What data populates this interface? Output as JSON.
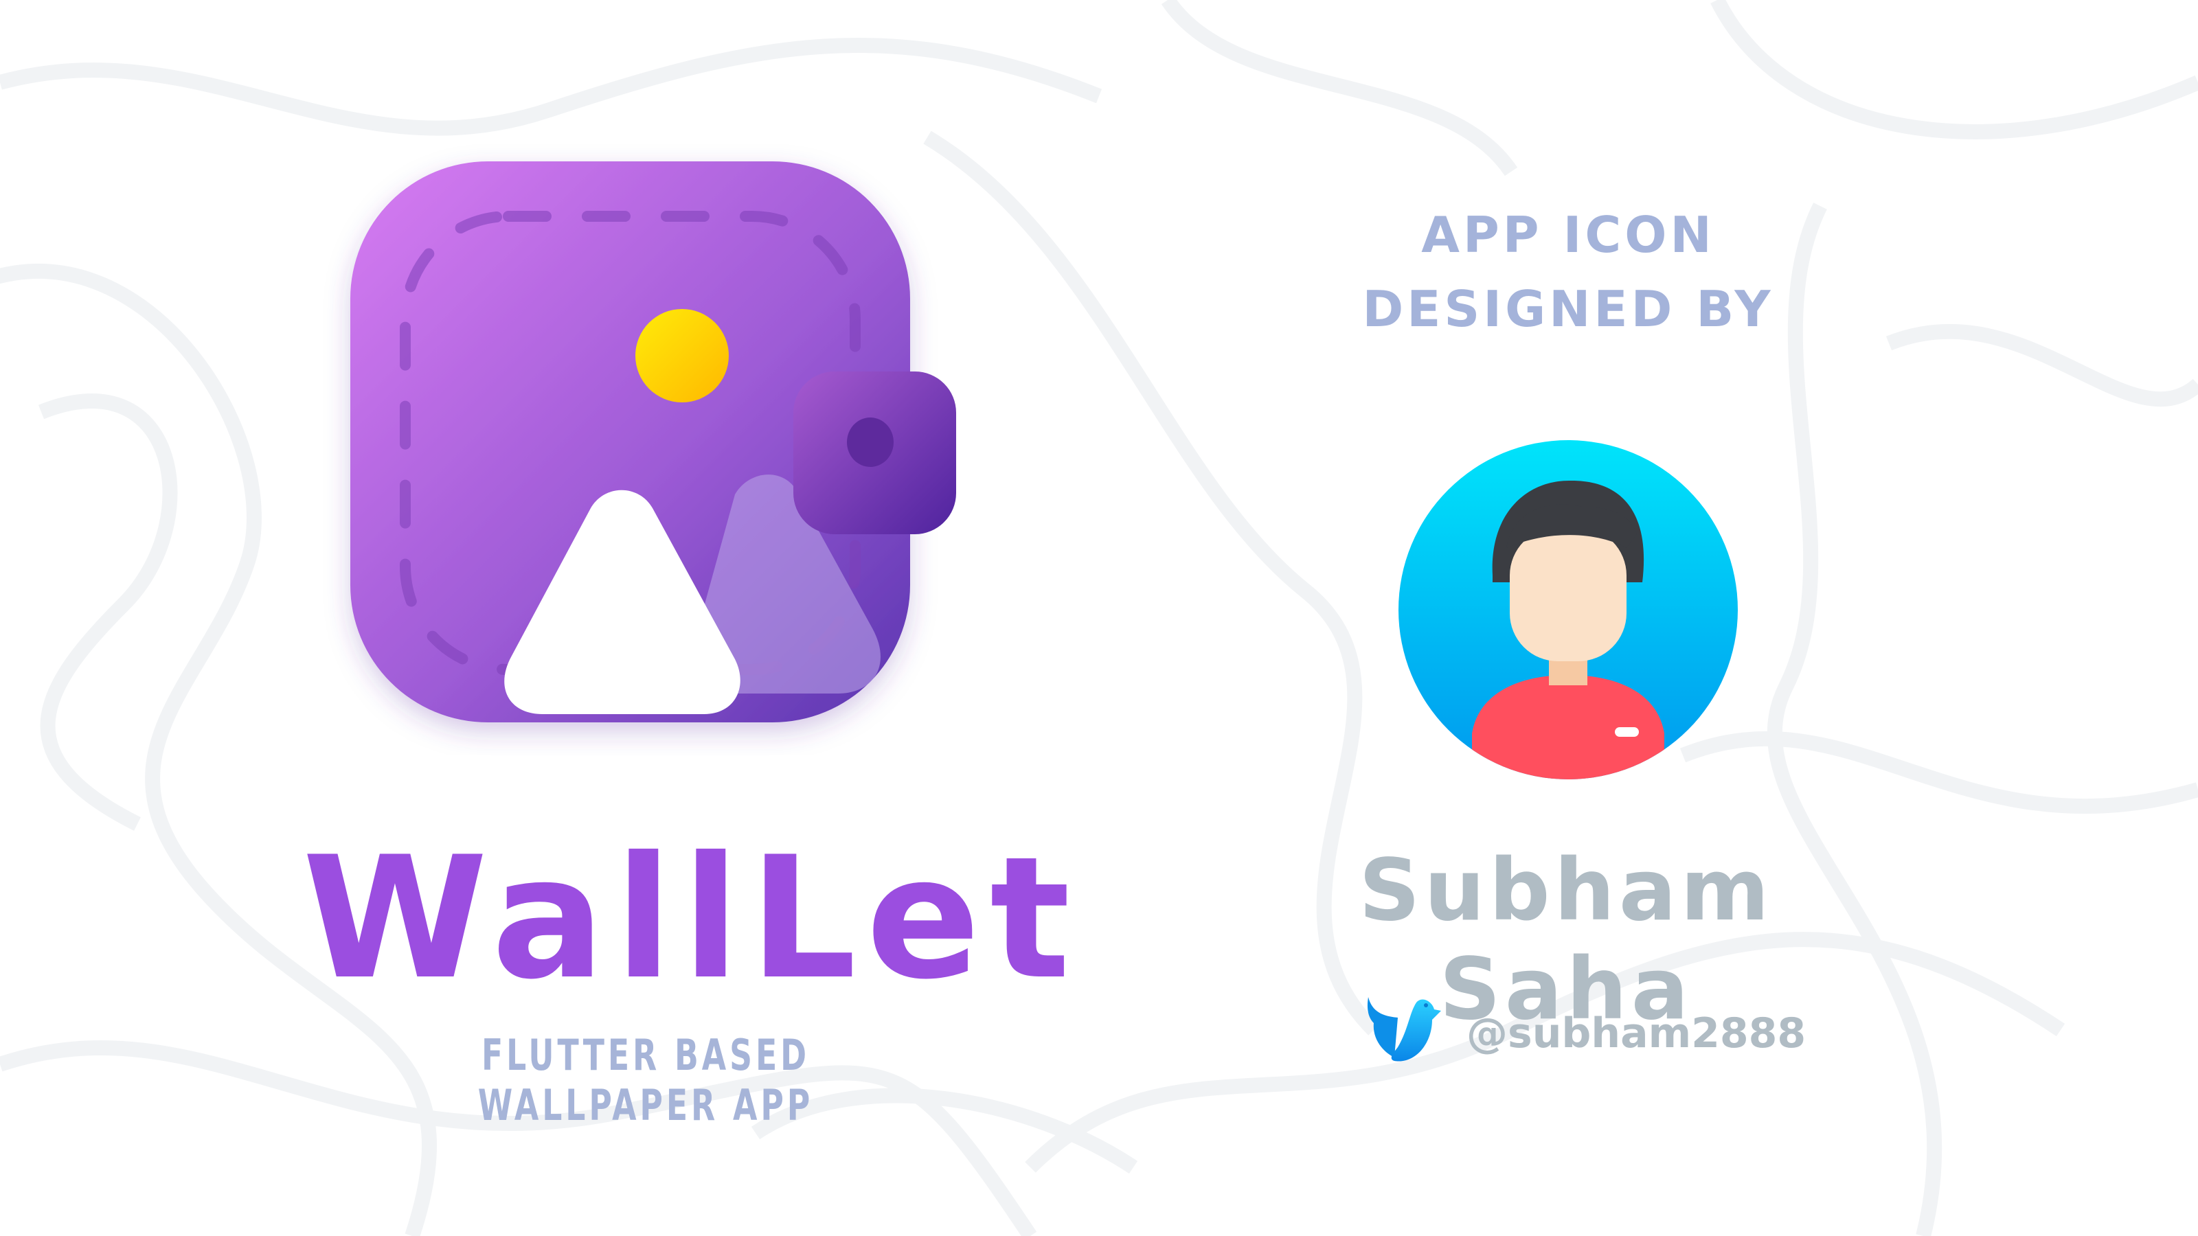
{
  "app": {
    "name": "WallLet",
    "subtitle": "FLUTTER BASED WALLPAPER APP",
    "icon": "wallet-image-icon"
  },
  "credit": {
    "line1": "APP ICON",
    "line2": "DESIGNED BY",
    "author": "Subham Saha",
    "twitter_handle": "@subham2888",
    "avatar_icon": "user-avatar-icon",
    "social_icon": "twitter-bird-icon"
  },
  "colors": {
    "brand_purple": "#9b4ee0",
    "subtitle": "#a6b4d8",
    "author_gray": "#b0bcc4",
    "avatar_bg": "#00c6f5"
  }
}
